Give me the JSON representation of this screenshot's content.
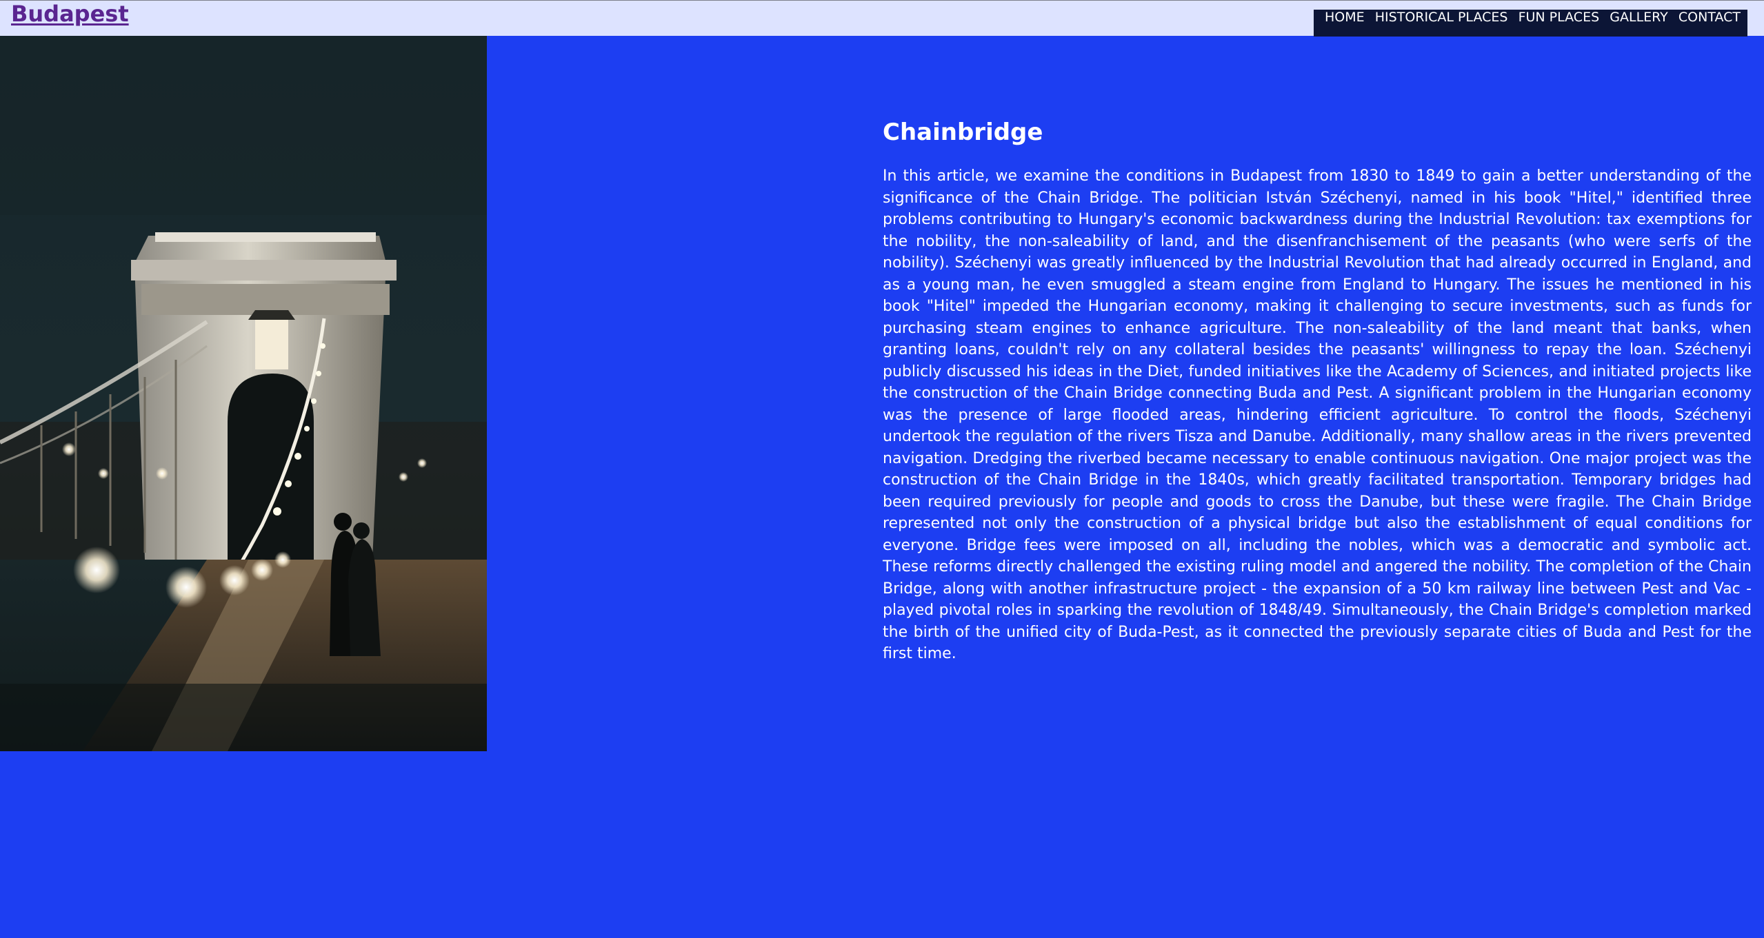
{
  "header": {
    "brand": "Budapest"
  },
  "nav": {
    "items": [
      {
        "label": "HOME"
      },
      {
        "label": "HISTORICAL PLACES"
      },
      {
        "label": "FUN PLACES"
      },
      {
        "label": "GALLERY"
      },
      {
        "label": "CONTACT"
      }
    ]
  },
  "colors": {
    "page_background": "#1d3ef2",
    "header_background": "#dde3ff",
    "nav_background": "#0c1536",
    "brand": "#5a2590",
    "text": "#ffffff"
  },
  "hero_image": {
    "subject": "chain-bridge-night-photo"
  },
  "article": {
    "title": "Chainbridge",
    "body": "In this article, we examine the conditions in Budapest from 1830 to 1849 to gain a better understanding of the significance of the Chain Bridge. The politician István Széchenyi, named in his book \"Hitel,\" identified three problems contributing to Hungary's economic backwardness during the Industrial Revolution: tax exemptions for the nobility, the non-saleability of land, and the disenfranchisement of the peasants (who were serfs of the nobility). Széchenyi was greatly influenced by the Industrial Revolution that had already occurred in England, and as a young man, he even smuggled a steam engine from England to Hungary. The issues he mentioned in his book \"Hitel\" impeded the Hungarian economy, making it challenging to secure investments, such as funds for purchasing steam engines to enhance agriculture. The non-saleability of the land meant that banks, when granting loans, couldn't rely on any collateral besides the peasants' willingness to repay the loan. Széchenyi publicly discussed his ideas in the Diet, funded initiatives like the Academy of Sciences, and initiated projects like the construction of the Chain Bridge connecting Buda and Pest. A significant problem in the Hungarian economy was the presence of large flooded areas, hindering efficient agriculture. To control the floods, Széchenyi undertook the regulation of the rivers Tisza and Danube. Additionally, many shallow areas in the rivers prevented navigation. Dredging the riverbed became necessary to enable continuous navigation. One major project was the construction of the Chain Bridge in the 1840s, which greatly facilitated transportation. Temporary bridges had been required previously for people and goods to cross the Danube, but these were fragile. The Chain Bridge represented not only the construction of a physical bridge but also the establishment of equal conditions for everyone. Bridge fees were imposed on all, including the nobles, which was a democratic and symbolic act. These reforms directly challenged the existing ruling model and angered the nobility. The completion of the Chain Bridge, along with another infrastructure project - the expansion of a 50 km railway line between Pest and Vac - played pivotal roles in sparking the revolution of 1848/49. Simultaneously, the Chain Bridge's completion marked the birth of the unified city of Buda-Pest, as it connected the previously separate cities of Buda and Pest for the first time."
  }
}
